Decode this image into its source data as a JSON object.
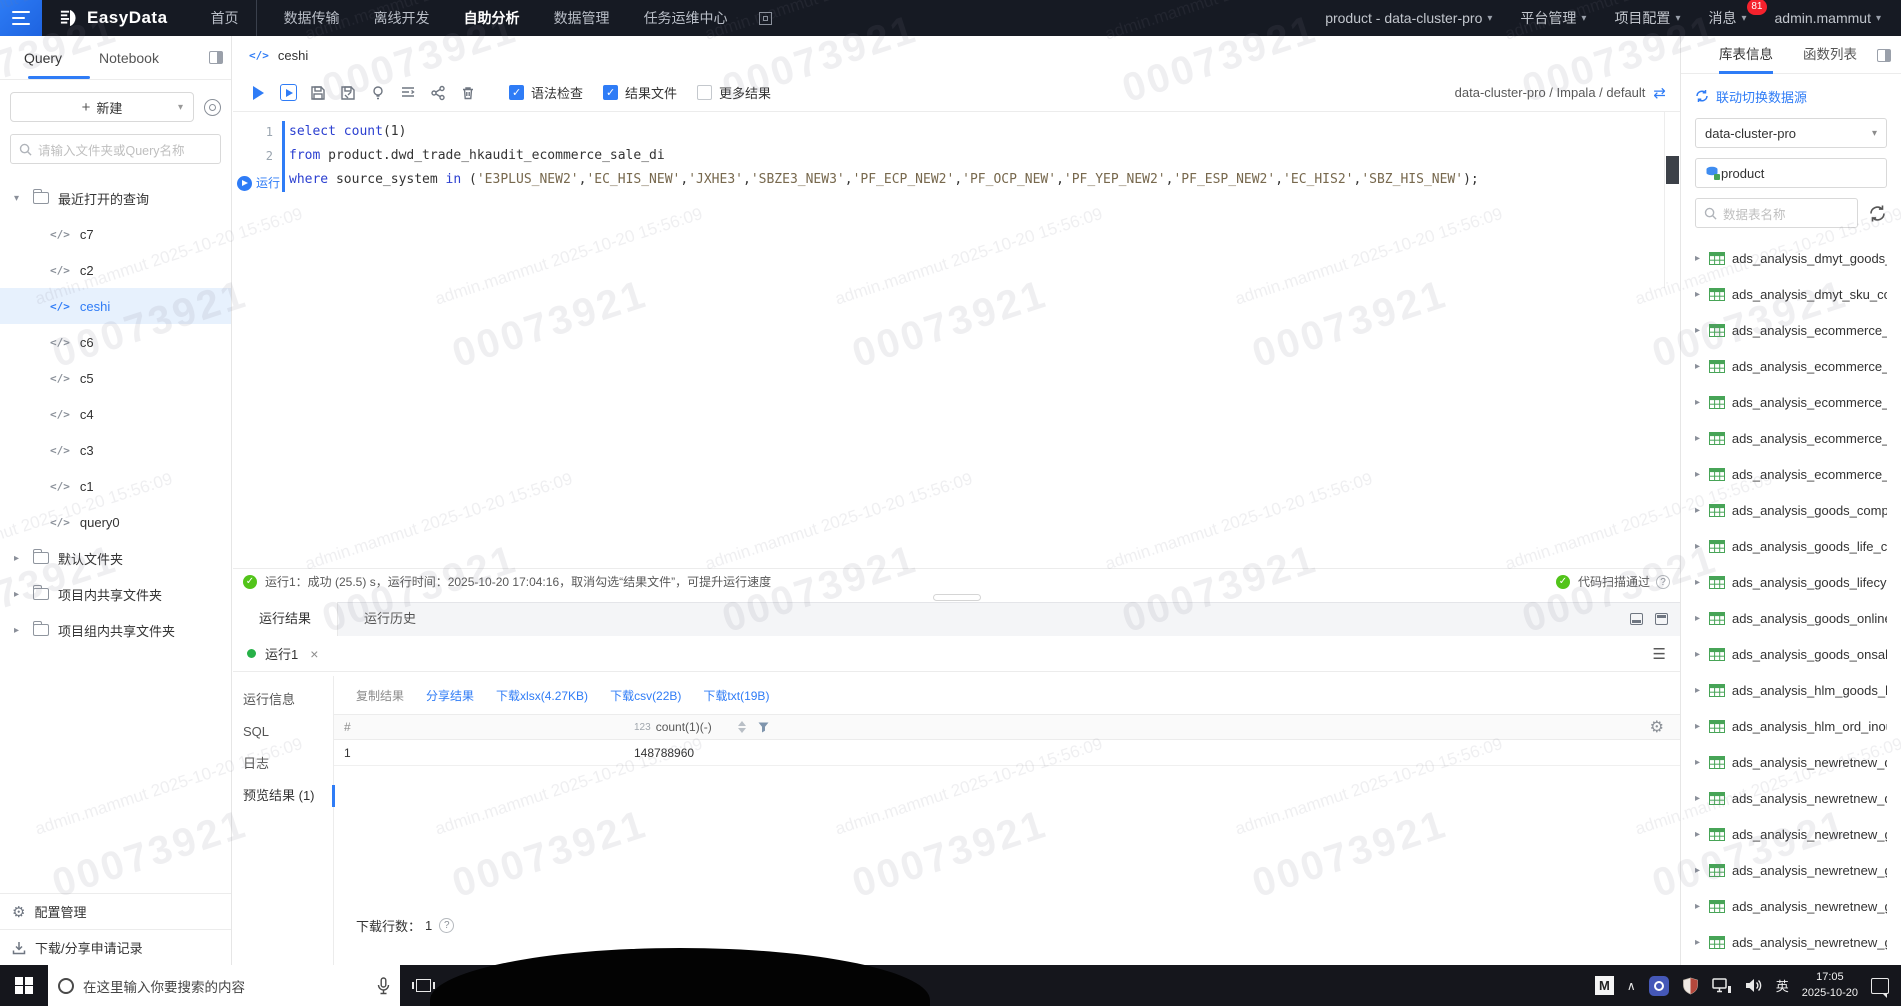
{
  "icons": {
    "caret_down": "▾",
    "caret_right": "▸",
    "plus": "+",
    "swap": "⇄",
    "gear": "⚙",
    "close": "×",
    "menu": "☰",
    "question": "?",
    "check": "✓",
    "chevron_up": "∧",
    "code": "</>"
  },
  "topbar": {
    "logo_text": "EasyData",
    "nav": [
      {
        "label": "首页",
        "active": false
      },
      {
        "label": "数据传输",
        "active": false
      },
      {
        "label": "离线开发",
        "active": false
      },
      {
        "label": "自助分析",
        "active": true
      },
      {
        "label": "数据管理",
        "active": false
      },
      {
        "label": "任务运维中心",
        "active": false
      }
    ],
    "project_selector": "product - data-cluster-pro",
    "platform_menu": "平台管理",
    "project_menu": "项目配置",
    "messages_label": "消息",
    "messages_badge": "81",
    "user_menu": "admin.mammut"
  },
  "sidebar": {
    "tabs": [
      {
        "label": "Query",
        "active": true
      },
      {
        "label": "Notebook",
        "active": false
      }
    ],
    "new_button": "新建",
    "search_placeholder": "请输入文件夹或Query名称",
    "recent_folder": "最近打开的查询",
    "files": [
      {
        "name": "c7",
        "selected": false
      },
      {
        "name": "c2",
        "selected": false
      },
      {
        "name": "ceshi",
        "selected": true
      },
      {
        "name": "c6",
        "selected": false
      },
      {
        "name": "c5",
        "selected": false
      },
      {
        "name": "c4",
        "selected": false
      },
      {
        "name": "c3",
        "selected": false
      },
      {
        "name": "c1",
        "selected": false
      },
      {
        "name": "query0",
        "selected": false
      }
    ],
    "folders": [
      "默认文件夹",
      "项目内共享文件夹",
      "项目组内共享文件夹"
    ],
    "footer": [
      {
        "label": "配置管理"
      },
      {
        "label": "下载/分享申请记录"
      }
    ]
  },
  "editor": {
    "tab_name": "ceshi",
    "toolbar_checkboxes": [
      {
        "label": "语法检查",
        "checked": true
      },
      {
        "label": "结果文件",
        "checked": true
      },
      {
        "label": "更多结果",
        "checked": false
      }
    ],
    "connection": "data-cluster-pro / Impala / default",
    "run_badge": "运行",
    "lines": [
      {
        "num": "1",
        "badge": false,
        "tokens": [
          [
            "kw",
            "select"
          ],
          [
            "pl",
            " "
          ],
          [
            "fn",
            "count"
          ],
          [
            "pl",
            "("
          ],
          [
            "num",
            "1"
          ],
          [
            "pl",
            ")"
          ]
        ]
      },
      {
        "num": "2",
        "badge": false,
        "tokens": [
          [
            "kw",
            "from"
          ],
          [
            "pl",
            " product.dwd_trade_hkaudit_ecommerce_sale_di"
          ]
        ]
      },
      {
        "num": "3",
        "badge": true,
        "tokens": [
          [
            "kw",
            "where"
          ],
          [
            "pl",
            " source_system "
          ],
          [
            "kw",
            "in"
          ],
          [
            "pl",
            " ("
          ],
          [
            "str",
            "'E3PLUS_NEW2'"
          ],
          [
            "pl",
            ","
          ],
          [
            "str",
            "'EC_HIS_NEW'"
          ],
          [
            "pl",
            ","
          ],
          [
            "str",
            "'JXHE3'"
          ],
          [
            "pl",
            ","
          ],
          [
            "str",
            "'SBZE3_NEW3'"
          ],
          [
            "pl",
            ","
          ],
          [
            "str",
            "'PF_ECP_NEW2'"
          ],
          [
            "pl",
            ","
          ],
          [
            "str",
            "'PF_OCP_NEW'"
          ],
          [
            "pl",
            ","
          ],
          [
            "str",
            "'PF_YEP_NEW2'"
          ],
          [
            "pl",
            ","
          ],
          [
            "str",
            "'PF_ESP_NEW2'"
          ],
          [
            "pl",
            ","
          ],
          [
            "str",
            "'EC_HIS2'"
          ],
          [
            "pl",
            ","
          ],
          [
            "str",
            "'SBZ_HIS_NEW'"
          ],
          [
            "pl",
            ");"
          ]
        ]
      }
    ]
  },
  "status": {
    "message": "运行1：成功 (25.5) s，运行时间：2025-10-20 17:04:16，取消勾选“结果文件”，可提升运行速度",
    "scan_result": "代码扫描通过"
  },
  "results": {
    "tabs": [
      {
        "label": "运行结果",
        "active": true
      },
      {
        "label": "运行历史",
        "active": false
      }
    ],
    "run_tab": "运行1",
    "menu": [
      {
        "label": "运行信息",
        "selected": false
      },
      {
        "label": "SQL",
        "selected": false
      },
      {
        "label": "日志",
        "selected": false
      },
      {
        "label": "预览结果 (1)",
        "selected": true
      }
    ],
    "actions": [
      {
        "label": "复制结果",
        "type": "muted"
      },
      {
        "label": "分享结果",
        "type": "link"
      },
      {
        "label": "下载xlsx(4.27KB)",
        "type": "link"
      },
      {
        "label": "下载csv(22B)",
        "type": "link"
      },
      {
        "label": "下载txt(19B)",
        "type": "link"
      }
    ],
    "table": {
      "col1": "#",
      "type_badge": "123",
      "col2": "count(1)(-)",
      "rows": [
        [
          "1",
          "148788960"
        ]
      ]
    },
    "footer_label": "下载行数：",
    "footer_value": "1"
  },
  "rightpanel": {
    "tabs": [
      {
        "label": "库表信息",
        "active": true
      },
      {
        "label": "函数列表",
        "active": false
      }
    ],
    "switch_link": "联动切换数据源",
    "cluster": "data-cluster-pro",
    "database": "product",
    "search_placeholder": "数据表名称",
    "tables": [
      "ads_analysis_dmyt_goods_c...",
      "ads_analysis_dmyt_sku_com...",
      "ads_analysis_ecommerce_ch...",
      "ads_analysis_ecommerce_sa...",
      "ads_analysis_ecommerce_sk...",
      "ads_analysis_ecommerce_sk...",
      "ads_analysis_ecommerce_sk...",
      "ads_analysis_goods_complai...",
      "ads_analysis_goods_life_cycl...",
      "ads_analysis_goods_lifecycle...",
      "ads_analysis_goods_online_...",
      "ads_analysis_goods_onsale_...",
      "ads_analysis_hlm_goods_life...",
      "ads_analysis_hlm_ord_inouts...",
      "ads_analysis_newretnew_dm...",
      "ads_analysis_newretnew_dm...",
      "ads_analysis_newretnew_go...",
      "ads_analysis_newretnew_go...",
      "ads_analysis_newretnew_go...",
      "ads_analysis_newretnew_go..."
    ]
  },
  "taskbar": {
    "search_placeholder": "在这里输入你要搜索的内容",
    "lang": "英",
    "time": "17:05",
    "date": "2025-10-20"
  },
  "watermark": {
    "line1": "admin.mammut 2025-10-20 15:56:09",
    "line2": "00073921"
  }
}
